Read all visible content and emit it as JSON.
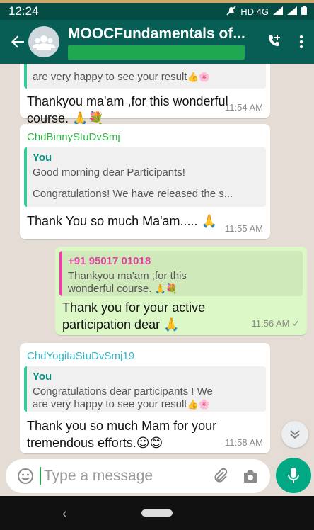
{
  "status": {
    "time": "12:24",
    "network": "HD 4G"
  },
  "header": {
    "title": "MOOCFundamentals of..."
  },
  "messages": [
    {
      "quote_tail": "are very happy to see your result",
      "quote_tail_emoji": "👍🌸",
      "text": "Thankyou ma'am ,for this wonderful course.",
      "text_emoji": "🙏💐",
      "time": "11:54 AM"
    },
    {
      "sender": "ChdBinnyStuDvSmj",
      "quote_name": "You",
      "quote_line1": "Good morning dear Participants!",
      "quote_line2": "Congratulations! We have released the s...",
      "text": "Thank You so much Ma'am.....",
      "text_emoji": "🙏",
      "time": "11:55 AM"
    },
    {
      "quote_name": "+91 95017 01018",
      "quote_text": "Thankyou ma'am ,for this wonderful course.",
      "quote_emoji": "🙏💐",
      "text": "Thank you for your active participation dear",
      "text_emoji": "🙏",
      "time": "11:56 AM",
      "tick": "✓"
    },
    {
      "sender": "ChdYogitaStuDvSmj19",
      "quote_name": "You",
      "quote_line1": "Congratulations dear participants ! We",
      "quote_line2": "are very happy to see your result",
      "quote_emoji": "👍🌸",
      "text": "Thank you so much Mam for your tremendous efforts.",
      "text_emoji": "☺😊",
      "time": "11:58 AM"
    }
  ],
  "composer": {
    "placeholder": "Type a message"
  },
  "colors": {
    "header": "#075e54",
    "status": "#054d44",
    "chat_bg": "#e5ddd5",
    "outgoing": "#dcf8c6",
    "accent": "#00a884"
  },
  "icons": [
    "back-arrow-icon",
    "group-avatar-icon",
    "add-call-icon",
    "more-vert-icon",
    "emoji-icon",
    "attach-icon",
    "camera-icon",
    "mic-icon",
    "scroll-down-icon"
  ]
}
